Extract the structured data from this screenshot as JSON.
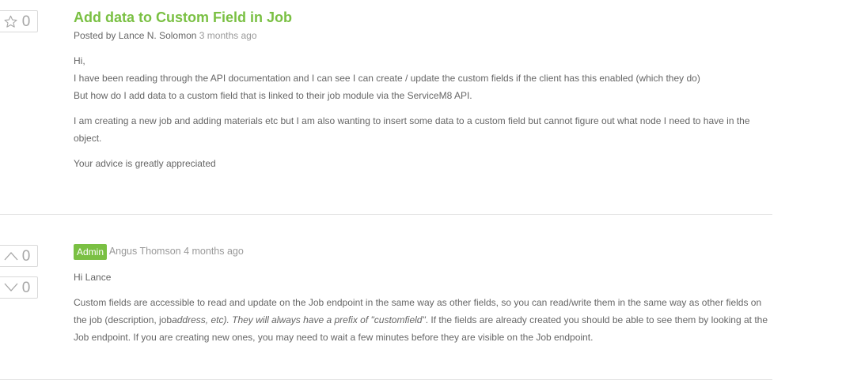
{
  "question": {
    "vote_count": "0",
    "title": "Add data to Custom Field in Job",
    "posted_by_prefix": "Posted by",
    "author": "Lance N. Solomon",
    "time": "3 months ago",
    "greeting": "Hi,",
    "line1": "I have been reading through the API documentation and I can see I can create / update the custom fields if the client has this enabled (which they do)",
    "line2": "But how do I add data to a custom field that is linked to their job module via the ServiceM8 API.",
    "para2": "I am creating a new job and adding materials etc but I am also wanting to insert some data to a custom field but cannot figure out what node I need to have in the object.",
    "para3": "Your advice is greatly appreciated"
  },
  "answer": {
    "upvotes": "0",
    "downvotes": "0",
    "badge": "Admin",
    "author": "Angus Thomson",
    "time": "4 months ago",
    "greeting": "Hi Lance",
    "body_a": "Custom fields are accessible to read and update on the Job endpoint in the same way as other fields, so you can read/write them in the same way as other fields on the job (description, job",
    "body_em": "address, etc). They will always have a prefix of \"customfield\"",
    "body_b": ". If the fields are already created you should be able to see them by looking at the Job endpoint. If you are creating new ones, you may need to wait a few minutes before they are visible on the Job endpoint."
  },
  "colors": {
    "accent_green": "#7ac043",
    "divider": "#e6e6e6",
    "muted_text": "#999999"
  },
  "icons": {
    "question_vote": "star-outline-icon",
    "answer_up": "chevron-up-icon",
    "answer_down": "chevron-down-icon"
  }
}
